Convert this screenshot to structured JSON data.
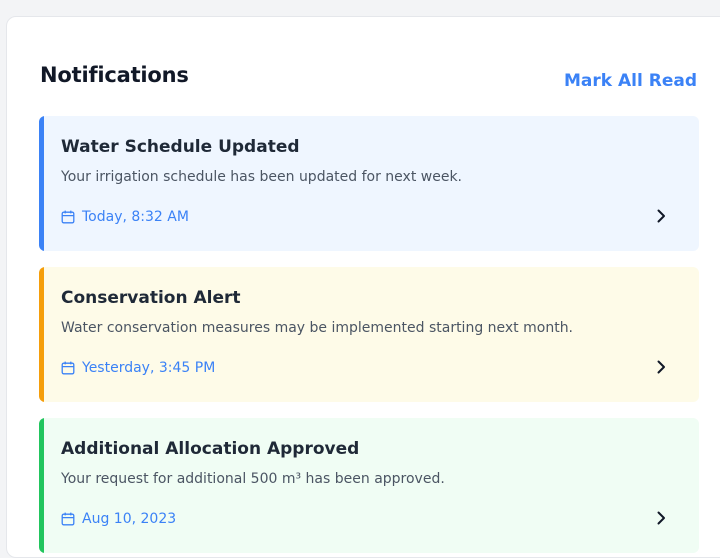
{
  "header": {
    "title": "Notifications",
    "mark_all_label": "Mark All Read"
  },
  "notifications": [
    {
      "title": "Water Schedule Updated",
      "body": "Your irrigation schedule has been updated for next week.",
      "date": "Today, 8:32 AM",
      "accent_color": "#3b82f6",
      "background_color": "#eff6ff",
      "date_icon": "calendar-icon",
      "action_icon": "chevron-right-icon"
    },
    {
      "title": "Conservation Alert",
      "body": "Water conservation measures may be implemented starting next month.",
      "date": "Yesterday, 3:45 PM",
      "accent_color": "#f59e0b",
      "background_color": "#fefbe8",
      "date_icon": "calendar-icon",
      "action_icon": "chevron-right-icon"
    },
    {
      "title": "Additional Allocation Approved",
      "body": "Your request for additional 500 m³ has been approved.",
      "date": "Aug 10, 2023",
      "accent_color": "#22c55e",
      "background_color": "#f0fdf4",
      "date_icon": "calendar-icon",
      "action_icon": "chevron-right-icon"
    }
  ]
}
